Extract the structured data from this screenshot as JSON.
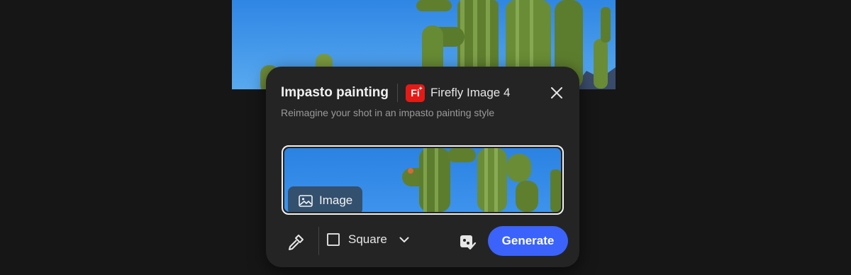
{
  "background": {
    "icon": "cactus-photo",
    "sky_color": "#3d8fe6"
  },
  "panel": {
    "title": "Impasto painting",
    "model": {
      "logo_text": "Fi",
      "logo_color": "#e41a16",
      "name": "Firefly Image 4"
    },
    "subtitle": "Reimagine your shot in an impasto painting style",
    "close_icon": "close-icon"
  },
  "reference": {
    "chip_label": "Image",
    "chip_icon": "image-icon"
  },
  "toolbar": {
    "eyedropper_icon": "eyedropper-icon",
    "aspect_label": "Square",
    "aspect_icon": "square-icon",
    "dropdown_icon": "chevron-down-icon",
    "credits_icon": "content-credentials-icon",
    "generate_label": "Generate",
    "generate_color": "#3b63fb"
  }
}
